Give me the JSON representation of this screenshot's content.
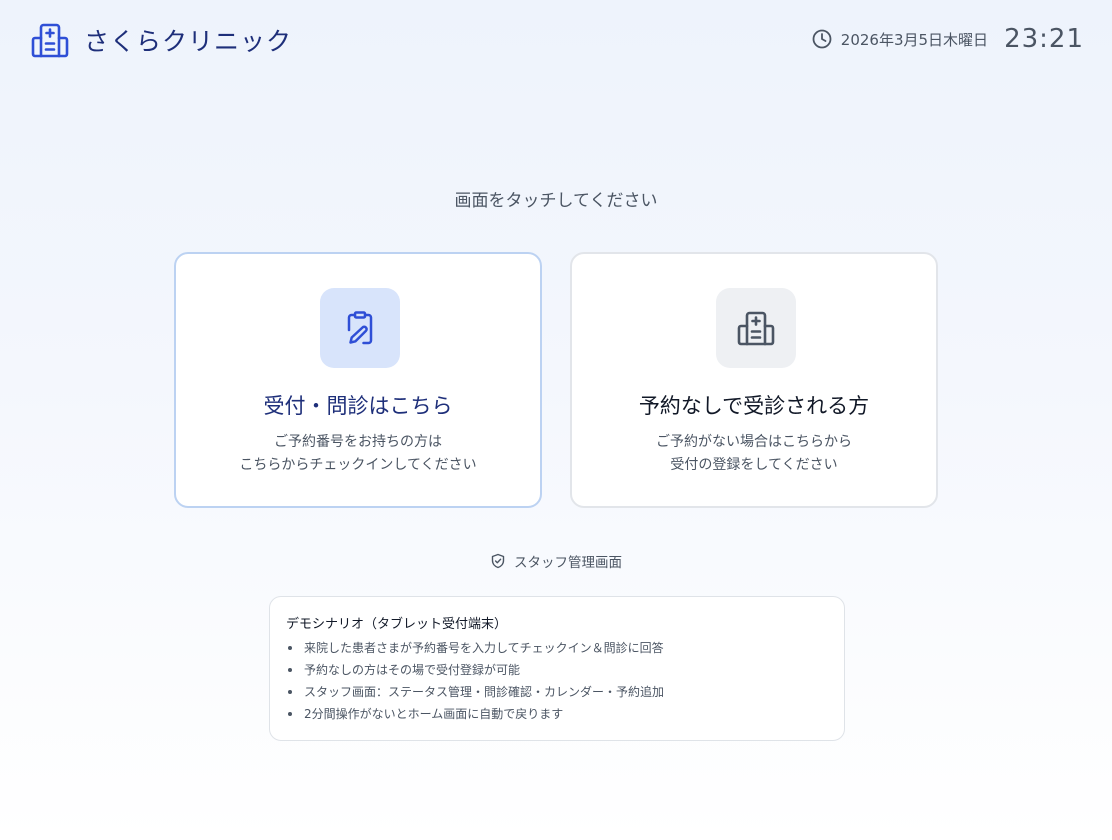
{
  "header": {
    "clinic_name": "さくらクリニック",
    "logo_icon": "hospital-icon",
    "date": "2026年3月5日木曜日",
    "time": "23:21",
    "clock_icon": "clock-icon",
    "accent_color": "#2f4fd6"
  },
  "main": {
    "prompt": "画面をタッチしてください",
    "cards": [
      {
        "title": "受付・問診はこちら",
        "desc_line1": "ご予約番号をお持ちの方は",
        "desc_line2": "こちらからチェックインしてください",
        "icon": "clipboard-pen-icon",
        "icon_bg": "#d8e4fb"
      },
      {
        "title": "予約なしで受診される方",
        "desc_line1": "ご予約がない場合はこちらから",
        "desc_line2": "受付の登録をしてください",
        "icon": "hospital-icon",
        "icon_bg": "#eef0f3"
      }
    ],
    "staff_link": {
      "label": "スタッフ管理画面",
      "icon": "shield-check-icon"
    }
  },
  "demo": {
    "title": "デモシナリオ（タブレット受付端末）",
    "items": [
      "来院した患者さまが予約番号を入力してチェックイン＆問診に回答",
      "予約なしの方はその場で受付登録が可能",
      "スタッフ画面：ステータス管理・問診確認・カレンダー・予約追加",
      "2分間操作がないとホーム画面に自動で戻ります"
    ]
  }
}
